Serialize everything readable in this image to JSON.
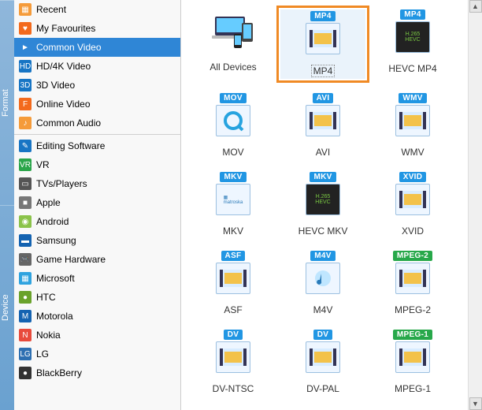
{
  "tabs": {
    "format": "Format",
    "device": "Device"
  },
  "formatNav": [
    {
      "label": "Recent",
      "icon": "recent-icon",
      "color": "#f59b3a"
    },
    {
      "label": "My Favourites",
      "icon": "heart-icon",
      "color": "#f36a1d"
    },
    {
      "label": "Common Video",
      "icon": "video-icon",
      "color": "#ffffff",
      "selected": true
    },
    {
      "label": "HD/4K Video",
      "icon": "hd-icon",
      "color": "#1875c4"
    },
    {
      "label": "3D Video",
      "icon": "3d-icon",
      "color": "#1875c4"
    },
    {
      "label": "Online Video",
      "icon": "online-icon",
      "color": "#f36a1d"
    },
    {
      "label": "Common Audio",
      "icon": "audio-icon",
      "color": "#f59b3a"
    }
  ],
  "deviceNav": [
    {
      "label": "Editing Software",
      "icon": "editing-icon",
      "color": "#1875c4"
    },
    {
      "label": "VR",
      "icon": "vr-icon",
      "color": "#2aa54a"
    },
    {
      "label": "TVs/Players",
      "icon": "tv-icon",
      "color": "#555555"
    },
    {
      "label": "Apple",
      "icon": "apple-icon",
      "color": "#777777"
    },
    {
      "label": "Android",
      "icon": "android-icon",
      "color": "#8bc34a"
    },
    {
      "label": "Samsung",
      "icon": "samsung-icon",
      "color": "#1463b1"
    },
    {
      "label": "Game Hardware",
      "icon": "game-icon",
      "color": "#666666"
    },
    {
      "label": "Microsoft",
      "icon": "microsoft-icon",
      "color": "#2fa3df"
    },
    {
      "label": "HTC",
      "icon": "htc-icon",
      "color": "#6aa22b"
    },
    {
      "label": "Motorola",
      "icon": "motorola-icon",
      "color": "#1463b1"
    },
    {
      "label": "Nokia",
      "icon": "nokia-icon",
      "color": "#e84b3c"
    },
    {
      "label": "LG",
      "icon": "lg-icon",
      "color": "#2d6fb1"
    },
    {
      "label": "BlackBerry",
      "icon": "blackberry-icon",
      "color": "#333333"
    }
  ],
  "tiles": [
    {
      "label": "All Devices",
      "badge": "",
      "variant": "devices"
    },
    {
      "label": "MP4",
      "badge": "MP4",
      "variant": "light",
      "selected": true
    },
    {
      "label": "HEVC MP4",
      "badge": "MP4",
      "variant": "hevc"
    },
    {
      "label": "MOV",
      "badge": "MOV",
      "variant": "qt"
    },
    {
      "label": "AVI",
      "badge": "AVI",
      "variant": "light"
    },
    {
      "label": "WMV",
      "badge": "WMV",
      "variant": "light"
    },
    {
      "label": "MKV",
      "badge": "MKV",
      "variant": "mkv"
    },
    {
      "label": "HEVC MKV",
      "badge": "MKV",
      "variant": "hevc"
    },
    {
      "label": "XVID",
      "badge": "XVID",
      "variant": "light"
    },
    {
      "label": "ASF",
      "badge": "ASF",
      "variant": "light"
    },
    {
      "label": "M4V",
      "badge": "M4V",
      "variant": "itunes"
    },
    {
      "label": "MPEG-2",
      "badge": "MPEG-2",
      "variant": "light",
      "badgeColor": "green"
    },
    {
      "label": "DV-NTSC",
      "badge": "DV",
      "variant": "light"
    },
    {
      "label": "DV-PAL",
      "badge": "DV",
      "variant": "light"
    },
    {
      "label": "MPEG-1",
      "badge": "MPEG-1",
      "variant": "light",
      "badgeColor": "green"
    }
  ]
}
